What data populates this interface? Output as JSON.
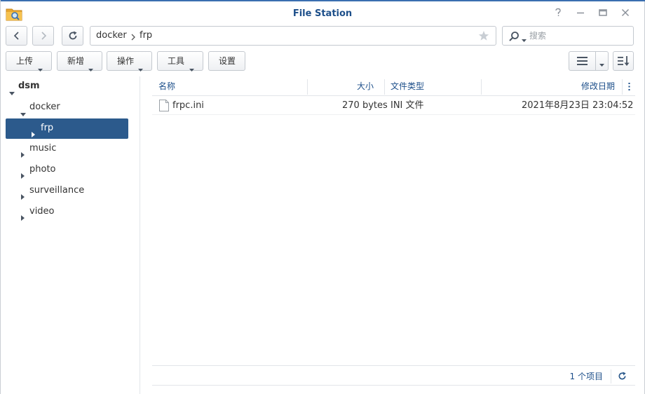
{
  "window": {
    "title": "File Station"
  },
  "nav": {
    "path": [
      "docker",
      "frp"
    ],
    "search_placeholder": "搜索"
  },
  "toolbar": {
    "upload": "上传",
    "create": "新增",
    "action": "操作",
    "tools": "工具",
    "settings": "设置"
  },
  "tree": {
    "root": "dsm",
    "docker": "docker",
    "frp": "frp",
    "music": "music",
    "photo": "photo",
    "surveillance": "surveillance",
    "video": "video"
  },
  "list": {
    "columns": {
      "name": "名称",
      "size": "大小",
      "type": "文件类型",
      "modified": "修改日期"
    },
    "rows": [
      {
        "name": "frpc.ini",
        "size": "270 bytes",
        "type": "INI 文件",
        "modified": "2021年8月23日 23:04:52"
      }
    ]
  },
  "footer": {
    "count": "1 个项目"
  },
  "colors": {
    "accent": "#2c5a8c",
    "title": "#1d4f8a",
    "topline": "#3a6fb0"
  },
  "icons": [
    "folder-search-icon",
    "help-icon",
    "minimize-icon",
    "maximize-icon",
    "close-icon",
    "back-icon",
    "forward-icon",
    "refresh-icon",
    "chevron-right-icon",
    "star-icon",
    "search-icon",
    "caret-down-icon",
    "list-view-icon",
    "sort-icon",
    "file-icon",
    "more-icon"
  ]
}
